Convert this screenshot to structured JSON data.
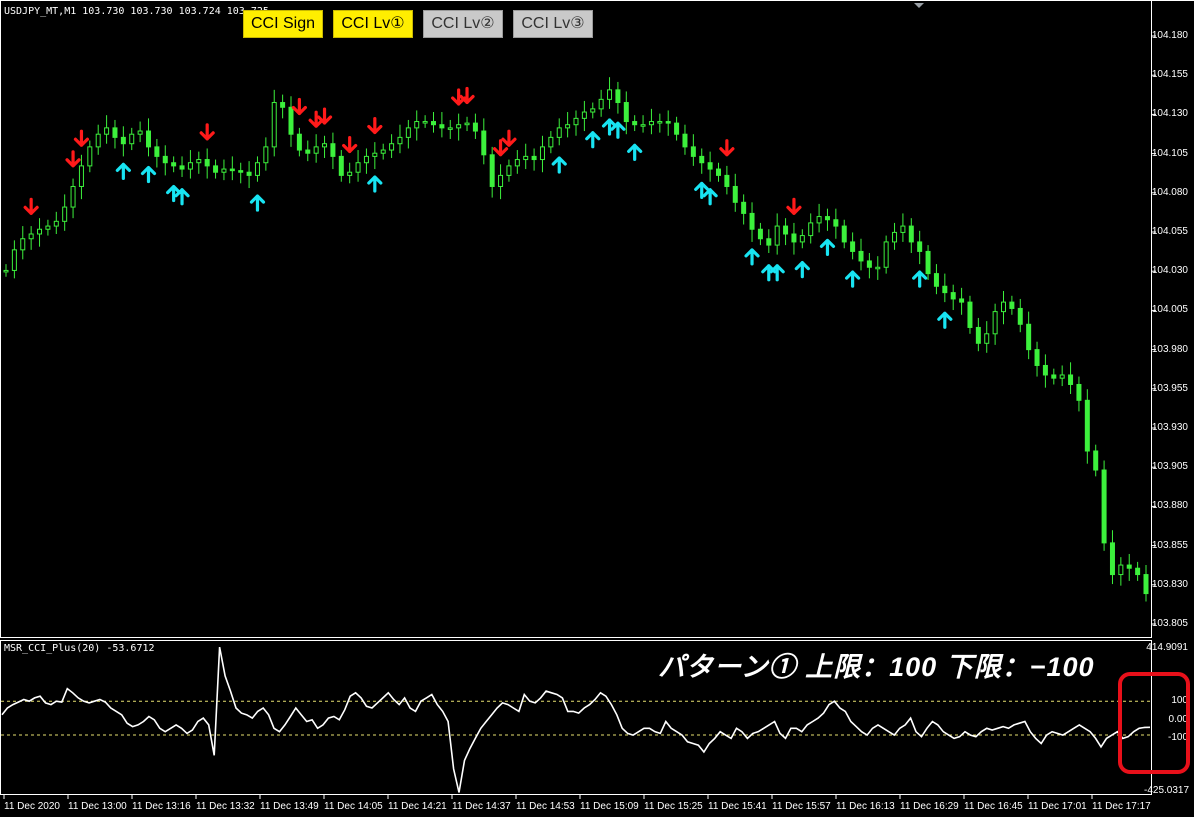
{
  "symbol_info": "USDJPY_MT,M1  103.730 103.730 103.724 103.725",
  "buttons": [
    {
      "label": "CCI Sign",
      "state": "on"
    },
    {
      "label": "CCI Lv①",
      "state": "on"
    },
    {
      "label": "CCI Lv②",
      "state": "off"
    },
    {
      "label": "CCI Lv③",
      "state": "off"
    }
  ],
  "price_axis": [
    "104.180",
    "104.155",
    "104.130",
    "104.105",
    "104.080",
    "104.055",
    "104.030",
    "104.005",
    "103.980",
    "103.955",
    "103.930",
    "103.905",
    "103.880",
    "103.855",
    "103.830",
    "103.805"
  ],
  "indicator": {
    "name": "MSR_CCI_Plus(20) -53.6712",
    "pattern_text": "パターン①  上限：100  下限：−100",
    "axis_top": "414.9091",
    "axis_100": "100",
    "axis_0": "0.00",
    "axis_m100": "-100",
    "axis_bottom": "-425.0317"
  },
  "time_axis": [
    "11 Dec 2020",
    "11 Dec 13:00",
    "11 Dec 13:16",
    "11 Dec 13:32",
    "11 Dec 13:49",
    "11 Dec 14:05",
    "11 Dec 14:21",
    "11 Dec 14:37",
    "11 Dec 14:53",
    "11 Dec 15:09",
    "11 Dec 15:25",
    "11 Dec 15:41",
    "11 Dec 15:57",
    "11 Dec 16:13",
    "11 Dec 16:29",
    "11 Dec 16:45",
    "11 Dec 17:01",
    "11 Dec 17:17"
  ],
  "colors": {
    "candles": "#3cf03c",
    "sell_arrow": "#ff1a1a",
    "buy_arrow": "#18e4f2",
    "cci_line": "#ffffff",
    "level_lines": "#e6e070",
    "highlight": "#e8101a"
  },
  "chart_data": {
    "type": "line",
    "price": {
      "ylim": [
        103.805,
        104.18
      ],
      "close": [
        104.032,
        104.045,
        104.052,
        104.055,
        104.058,
        104.06,
        104.063,
        104.072,
        104.085,
        104.098,
        104.11,
        104.118,
        104.122,
        104.116,
        104.112,
        104.118,
        104.12,
        104.11,
        104.104,
        104.1,
        104.098,
        104.096,
        104.1,
        104.102,
        104.098,
        104.094,
        104.096,
        104.095,
        104.094,
        104.092,
        104.1,
        104.11,
        104.138,
        104.135,
        104.118,
        104.108,
        104.106,
        104.11,
        104.112,
        104.104,
        104.092,
        104.094,
        104.1,
        104.104,
        104.106,
        104.108,
        104.112,
        104.116,
        104.122,
        104.126,
        104.126,
        104.124,
        104.122,
        104.122,
        104.124,
        104.125,
        104.12,
        104.105,
        104.085,
        104.092,
        104.098,
        104.102,
        104.104,
        104.102,
        104.11,
        104.116,
        104.122,
        104.124,
        104.128,
        104.132,
        104.134,
        104.14,
        104.146,
        104.138,
        104.126,
        104.124,
        104.124,
        104.126,
        104.126,
        104.125,
        104.118,
        104.11,
        104.104,
        104.1,
        104.096,
        104.092,
        104.085,
        104.075,
        104.068,
        104.058,
        104.052,
        104.048,
        104.06,
        104.055,
        104.05,
        104.054,
        104.062,
        104.066,
        104.064,
        104.06,
        104.05,
        104.044,
        104.038,
        104.034,
        104.034,
        104.05,
        104.056,
        104.06,
        104.05,
        104.044,
        104.03,
        104.022,
        104.018,
        104.014,
        104.012,
        103.996,
        103.986,
        103.992,
        104.006,
        104.012,
        104.008,
        103.998,
        103.982,
        103.972,
        103.966,
        103.964,
        103.966,
        103.96,
        103.95,
        103.918,
        103.906,
        103.86,
        103.84,
        103.846,
        103.844,
        103.84,
        103.828
      ],
      "sell_arrow_bars": [
        3,
        8,
        9,
        24,
        35,
        37,
        38,
        41,
        44,
        54,
        55,
        59,
        60,
        86,
        94
      ],
      "buy_arrow_bars": [
        14,
        17,
        20,
        21,
        30,
        44,
        66,
        70,
        72,
        73,
        75,
        83,
        84,
        89,
        91,
        92,
        95,
        98,
        101,
        109,
        112
      ]
    },
    "cci": {
      "ylim": [
        -425.0317,
        414.9091
      ],
      "levels": [
        100,
        0,
        -100
      ],
      "values": [
        20,
        60,
        80,
        95,
        110,
        100,
        120,
        130,
        90,
        80,
        100,
        95,
        175,
        150,
        120,
        100,
        90,
        100,
        110,
        95,
        60,
        40,
        20,
        -30,
        -50,
        -40,
        -20,
        10,
        -10,
        -60,
        -80,
        -60,
        -40,
        -60,
        -90,
        -70,
        -20,
        0,
        -40,
        -220,
        420,
        250,
        160,
        60,
        30,
        20,
        0,
        40,
        60,
        20,
        -60,
        -80,
        -40,
        10,
        60,
        20,
        -20,
        -10,
        -60,
        -40,
        0,
        10,
        -10,
        50,
        130,
        150,
        120,
        70,
        60,
        90,
        120,
        150,
        110,
        80,
        120,
        60,
        40,
        100,
        120,
        140,
        80,
        40,
        -20,
        -300,
        -440,
        -250,
        -180,
        -120,
        -60,
        -20,
        20,
        60,
        90,
        80,
        60,
        40,
        140,
        100,
        90,
        120,
        160,
        150,
        140,
        120,
        40,
        40,
        30,
        60,
        80,
        110,
        150,
        130,
        80,
        20,
        -60,
        -90,
        -100,
        -80,
        -60,
        -60,
        -80,
        -90,
        -20,
        -60,
        -80,
        -100,
        -140,
        -150,
        -160,
        -200,
        -150,
        -120,
        -80,
        -100,
        -120,
        -60,
        -80,
        -120,
        -90,
        -80,
        -60,
        -40,
        -20,
        -90,
        -120,
        -60,
        -60,
        -80,
        -40,
        -20,
        0,
        30,
        80,
        100,
        60,
        40,
        -20,
        -50,
        -80,
        -100,
        -60,
        -40,
        -60,
        -80,
        -100,
        -60,
        -40,
        0,
        -80,
        -110,
        -60,
        -20,
        -40,
        -80,
        -100,
        -120,
        -110,
        -80,
        -100,
        -110,
        -80,
        -60,
        -70,
        -60,
        -50,
        -60,
        -40,
        -30,
        -20,
        -80,
        -120,
        -150,
        -100,
        -80,
        -90,
        -100,
        -80,
        -60,
        -40,
        -60,
        -80,
        -120,
        -170,
        -120,
        -100,
        -80,
        -120,
        -110,
        -80,
        -60,
        -55,
        -54
      ]
    }
  }
}
